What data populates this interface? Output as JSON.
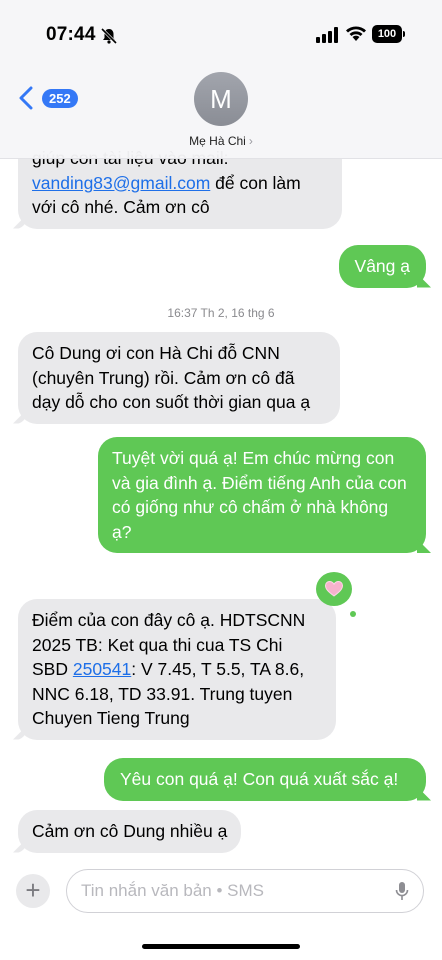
{
  "status_bar": {
    "time": "07:44",
    "battery": "100"
  },
  "header": {
    "back_count": "252",
    "avatar_initial": "M",
    "contact_name": "Mẹ Hà Chi",
    "contact_chevron": "›"
  },
  "messages": [
    {
      "side": "in",
      "text_before": "giúp con tài liệu vào mail: ",
      "link": "vanding83@gmail.com",
      "text_after": " để con làm với cô nhé. Cảm ơn cô"
    },
    {
      "side": "out",
      "text": "Vâng ạ"
    },
    {
      "side": "in",
      "text": "Cô Dung ơi con Hà Chi đỗ CNN (chuyên Trung) rồi. Cảm ơn cô đã dạy dỗ cho con suốt thời gian qua ạ"
    },
    {
      "side": "out",
      "text": "Tuyệt vời quá ạ! Em chúc mừng con và gia đình ạ. Điểm tiếng Anh của con có giống như cô chấm ở nhà không ạ?"
    },
    {
      "side": "in",
      "text_before": "Điểm của con đây cô ạ. HDTSCNN 2025 TB: Ket qua thi cua TS Chi SBD ",
      "link": "250541",
      "text_after": ": V 7.45, T 5.5, TA 8.6, NNC 6.18, TD 33.91. Trung tuyen Chuyen Tieng Trung"
    },
    {
      "side": "out",
      "text": "Yêu con quá ạ! Con quá xuất sắc ạ!"
    },
    {
      "side": "in",
      "text": "Cảm ơn cô Dung nhiều ạ"
    }
  ],
  "timestamp": "16:37 Th 2, 16 thg 6",
  "tapback_icon": "heart-icon",
  "composer": {
    "placeholder": "Tin nhắn văn bản • SMS",
    "plus": "+"
  },
  "colors": {
    "accent": "#3478f6",
    "outgoing": "#5fc855",
    "incoming": "#e9e9eb",
    "tapback_heart": "#f2a7c3"
  }
}
